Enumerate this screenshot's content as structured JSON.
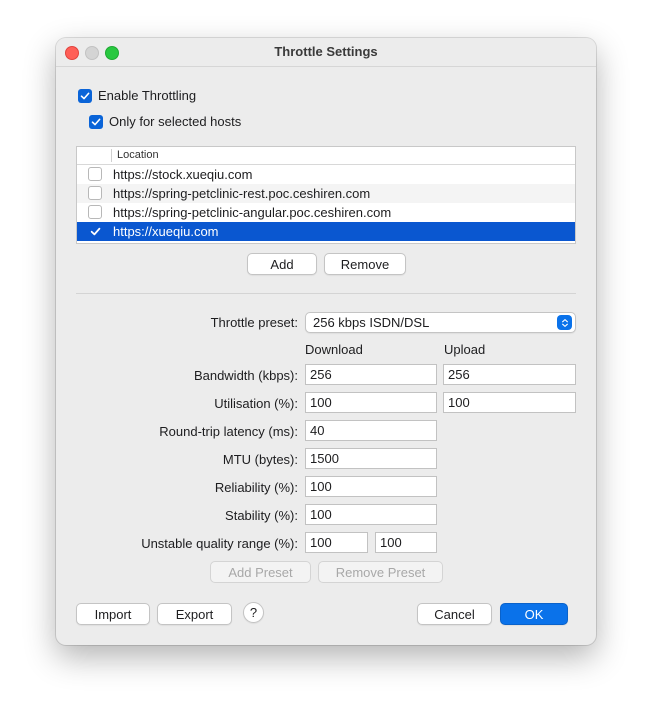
{
  "window": {
    "title": "Throttle Settings"
  },
  "options": {
    "enable_throttling": {
      "label": "Enable Throttling",
      "checked": true
    },
    "only_selected_hosts": {
      "label": "Only for selected hosts",
      "checked": true
    }
  },
  "hosts_table": {
    "column_header": "Location",
    "rows": [
      {
        "location": "https://stock.xueqiu.com",
        "checked": false,
        "selected": false
      },
      {
        "location": "https://spring-petclinic-rest.poc.ceshiren.com",
        "checked": false,
        "selected": false
      },
      {
        "location": "https://spring-petclinic-angular.poc.ceshiren.com",
        "checked": false,
        "selected": false
      },
      {
        "location": "https://xueqiu.com",
        "checked": true,
        "selected": true
      }
    ],
    "add_label": "Add",
    "remove_label": "Remove"
  },
  "preset": {
    "label": "Throttle preset:",
    "value": "256 kbps ISDN/DSL"
  },
  "columns": {
    "download": "Download",
    "upload": "Upload"
  },
  "fields": {
    "bandwidth": {
      "label": "Bandwidth (kbps):",
      "download": "256",
      "upload": "256"
    },
    "utilisation": {
      "label": "Utilisation (%):",
      "download": "100",
      "upload": "100"
    },
    "latency": {
      "label": "Round-trip latency (ms):",
      "value": "40"
    },
    "mtu": {
      "label": "MTU (bytes):",
      "value": "1500"
    },
    "reliability": {
      "label": "Reliability (%):",
      "value": "100"
    },
    "stability": {
      "label": "Stability (%):",
      "value": "100"
    },
    "unstable_range": {
      "label": "Unstable quality range (%):",
      "min": "100",
      "max": "100"
    }
  },
  "preset_buttons": {
    "add_preset": "Add Preset",
    "remove_preset": "Remove Preset"
  },
  "footer": {
    "import": "Import",
    "export": "Export",
    "help": "?",
    "cancel": "Cancel",
    "ok": "OK"
  },
  "colors": {
    "accent": "#0a72ea",
    "selection": "#0a57d0"
  }
}
